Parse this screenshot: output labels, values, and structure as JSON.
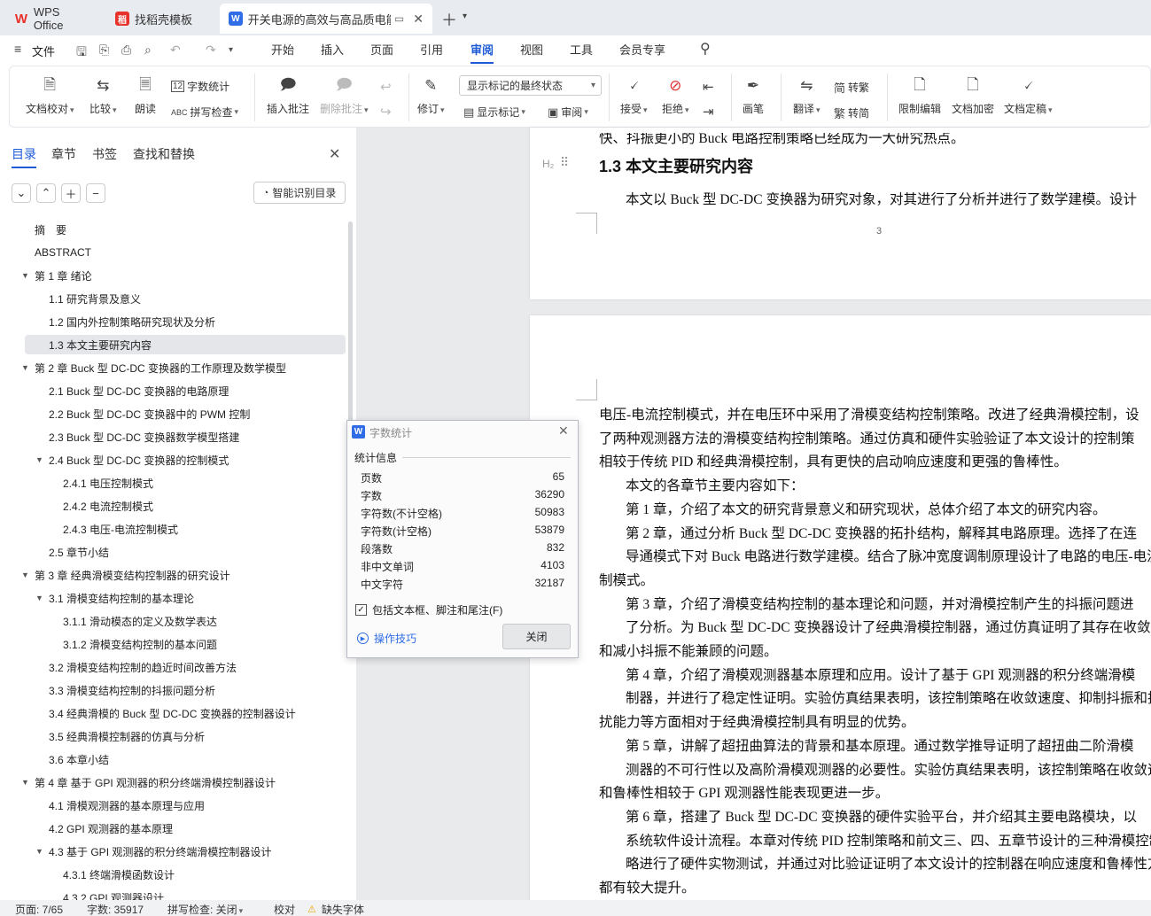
{
  "tabs": [
    {
      "label": "WPS Office",
      "icon": "wps-logo-icon"
    },
    {
      "label": "找稻壳模板",
      "icon": "docer-icon"
    },
    {
      "label": "开关电源的高效与高品质电能",
      "icon": "writer-doc-icon"
    }
  ],
  "menu": {
    "file": "文件",
    "items": [
      "开始",
      "插入",
      "页面",
      "引用",
      "审阅",
      "视图",
      "工具",
      "会员专享"
    ],
    "active": "审阅"
  },
  "ribbon": {
    "doc_proof": "文档校对",
    "compare": "比较",
    "read_aloud": "朗读",
    "word_count": "字数统计",
    "spell_check": "拼写检查",
    "insert_comment": "插入批注",
    "delete_comment": "删除批注",
    "revise": "修订",
    "markup_dropdown": "显示标记的最终状态",
    "show_markup": "显示标记",
    "review": "审阅",
    "accept": "接受",
    "reject": "拒绝",
    "pen": "画笔",
    "translate": "翻译",
    "trad": "转繁",
    "simp": "转简",
    "restrict": "限制编辑",
    "encrypt": "文档加密",
    "finalize": "文档定稿"
  },
  "nav": {
    "tabs": [
      "目录",
      "章节",
      "书签",
      "查找和替换"
    ],
    "smart_btn": "智能识别目录",
    "toc": [
      {
        "label": "摘　要",
        "level": 0
      },
      {
        "label": "ABSTRACT",
        "level": 0
      },
      {
        "label": "第 1 章  绪论",
        "level": 0,
        "exp": true
      },
      {
        "label": "1.1  研究背景及意义",
        "level": 1
      },
      {
        "label": "1.2  国内外控制策略研究现状及分析",
        "level": 1
      },
      {
        "label": "1.3  本文主要研究内容",
        "level": 1,
        "sel": true
      },
      {
        "label": "第 2 章  Buck 型 DC-DC 变换器的工作原理及数学模型",
        "level": 0,
        "exp": true
      },
      {
        "label": "2.1 Buck 型 DC-DC 变换器的电路原理",
        "level": 1
      },
      {
        "label": "2.2 Buck 型 DC-DC 变换器中的 PWM 控制",
        "level": 1
      },
      {
        "label": "2.3 Buck 型 DC-DC 变换器数学模型搭建",
        "level": 1
      },
      {
        "label": "2.4 Buck 型 DC-DC 变换器的控制模式",
        "level": 1,
        "exp": true
      },
      {
        "label": "2.4.1  电压控制模式",
        "level": 2
      },
      {
        "label": "2.4.2  电流控制模式",
        "level": 2
      },
      {
        "label": "2.4.3  电压-电流控制模式",
        "level": 2
      },
      {
        "label": "2.5 章节小结",
        "level": 1
      },
      {
        "label": "第 3 章  经典滑模变结构控制器的研究设计",
        "level": 0,
        "exp": true
      },
      {
        "label": "3.1 滑模变结构控制的基本理论",
        "level": 1,
        "exp": true
      },
      {
        "label": "3.1.1 滑动模态的定义及数学表达",
        "level": 2
      },
      {
        "label": "3.1.2 滑模变结构控制的基本问题",
        "level": 2
      },
      {
        "label": "3.2 滑模变结构控制的趋近时间改善方法",
        "level": 1
      },
      {
        "label": "3.3 滑模变结构控制的抖振问题分析",
        "level": 1
      },
      {
        "label": "3.4 经典滑模的 Buck 型 DC-DC 变换器的控制器设计",
        "level": 1
      },
      {
        "label": "3.5 经典滑模控制器的仿真与分析",
        "level": 1
      },
      {
        "label": "3.6 本章小结",
        "level": 1
      },
      {
        "label": "第 4 章  基于 GPI 观测器的积分终端滑模控制器设计",
        "level": 0,
        "exp": true
      },
      {
        "label": "4.1 滑模观测器的基本原理与应用",
        "level": 1
      },
      {
        "label": "4.2 GPI 观测器的基本原理",
        "level": 1
      },
      {
        "label": "4.3 基于 GPI 观测器的积分终端滑模控制器设计",
        "level": 1,
        "exp": true
      },
      {
        "label": "4.3.1  终端滑模函数设计",
        "level": 2
      },
      {
        "label": "4.3.2 GPI 观测器设计",
        "level": 2
      }
    ]
  },
  "doc": {
    "page1_top": "快、抖振更小的 Buck 电路控制策略已经成为一大研究热点。",
    "heading": "1.3  本文主要研究内容",
    "heading_marker": "H₂",
    "page1_para": "本文以 Buck 型 DC-DC 变换器为研究对象，对其进行了分析并进行了数学建模。设计",
    "page_number": "3",
    "lines": [
      "电压-电流控制模式，并在电压环中采用了滑模变结构控制策略。改进了经典滑模控制，设",
      "了两种观测器方法的滑模变结构控制策略。通过仿真和硬件实验验证了本文设计的控制策",
      "相较于传统 PID 和经典滑模控制，具有更快的启动响应速度和更强的鲁棒性。",
      "本文的各章节主要内容如下：",
      "第 1 章，介绍了本文的研究背景意义和研究现状，总体介绍了本文的研究内容。",
      "第 2 章，通过分析 Buck 型 DC-DC 变换器的拓扑结构，解释其电路原理。选择了在连",
      "导通模式下对 Buck 电路进行数学建模。结合了脉冲宽度调制原理设计了电路的电压-电流",
      "制模式。",
      "第 3 章，介绍了滑模变结构控制的基本理论和问题，并对滑模控制产生的抖振问题进",
      "了分析。为 Buck 型 DC-DC 变换器设计了经典滑模控制器，通过仿真证明了其存在收敛速",
      "和减小抖振不能兼顾的问题。",
      "第 4 章，介绍了滑模观测器基本原理和应用。设计了基于 GPI 观测器的积分终端滑模",
      "制器，并进行了稳定性证明。实验仿真结果表明，该控制策略在收敛速度、抑制抖振和抗",
      "扰能力等方面相对于经典滑模控制具有明显的优势。",
      "第 5 章，讲解了超扭曲算法的背景和基本原理。通过数学推导证明了超扭曲二阶滑模",
      "测器的不可行性以及高阶滑模观测器的必要性。实验仿真结果表明，该控制策略在收敛速",
      "和鲁棒性相较于 GPI 观测器性能表现更进一步。",
      "第 6 章，搭建了 Buck 型 DC-DC 变换器的硬件实验平台，并介绍其主要电路模块，以",
      "系统软件设计流程。本章对传统 PID 控制策略和前文三、四、五章节设计的三种滑模控制",
      "略进行了硬件实物测试，并通过对比验证证明了本文设计的控制器在响应速度和鲁棒性方",
      "都有较大提升。"
    ]
  },
  "dialog": {
    "title": "字数统计",
    "section": "统计信息",
    "stats": [
      {
        "label": "页数",
        "value": "65"
      },
      {
        "label": "字数",
        "value": "36290"
      },
      {
        "label": "字符数(不计空格)",
        "value": "50983"
      },
      {
        "label": "字符数(计空格)",
        "value": "53879"
      },
      {
        "label": "段落数",
        "value": "832"
      },
      {
        "label": "非中文单词",
        "value": "4103"
      },
      {
        "label": "中文字符",
        "value": "32187"
      }
    ],
    "checkbox": "包括文本框、脚注和尾注(F)",
    "checked": true,
    "tips": "操作技巧",
    "close": "关闭"
  },
  "status": {
    "page": "页面: 7/65",
    "words": "字数: 35917",
    "spell": "拼写检查: 关闭",
    "proof": "校对",
    "missing_font": "缺失字体"
  }
}
